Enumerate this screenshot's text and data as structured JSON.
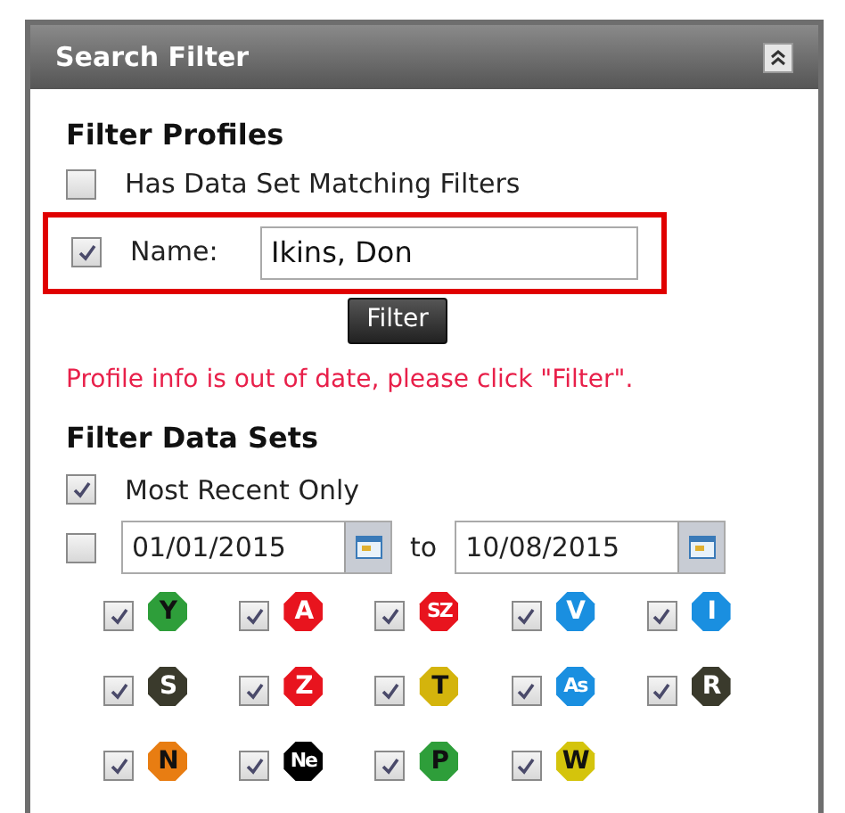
{
  "panel": {
    "title": "Search Filter"
  },
  "profiles": {
    "heading": "Filter Profiles",
    "has_data": {
      "label": "Has Data Set Matching Filters",
      "checked": false
    },
    "name": {
      "label": "Name:",
      "value": "Ikins, Don",
      "checked": true,
      "highlighted": true
    },
    "button": "Filter",
    "warning": "Profile info is out of date, please click \"Filter\"."
  },
  "data_sets": {
    "heading": "Filter Data Sets",
    "most_recent": {
      "label": "Most Recent Only",
      "checked": true
    },
    "date_range": {
      "checked": false,
      "from": "01/01/2015",
      "separator": "to",
      "to": "10/08/2015"
    },
    "badges": [
      {
        "label": "Y",
        "color": "#2e9e3a",
        "dark_text": true,
        "checked": true
      },
      {
        "label": "A",
        "color": "#e8141e",
        "dark_text": false,
        "checked": true
      },
      {
        "label": "SZ",
        "color": "#e8141e",
        "dark_text": false,
        "checked": true
      },
      {
        "label": "V",
        "color": "#1a8fe0",
        "dark_text": false,
        "checked": true
      },
      {
        "label": "I",
        "color": "#1a8fe0",
        "dark_text": false,
        "checked": true
      },
      {
        "label": "S",
        "color": "#3a3a2c",
        "dark_text": false,
        "checked": true
      },
      {
        "label": "Z",
        "color": "#e8141e",
        "dark_text": false,
        "checked": true
      },
      {
        "label": "T",
        "color": "#d4b40c",
        "dark_text": true,
        "checked": true
      },
      {
        "label": "As",
        "color": "#1a8fe0",
        "dark_text": false,
        "checked": true
      },
      {
        "label": "R",
        "color": "#3a3a2c",
        "dark_text": false,
        "checked": true
      },
      {
        "label": "N",
        "color": "#e87d12",
        "dark_text": true,
        "checked": true
      },
      {
        "label": "Ne",
        "color": "#000000",
        "dark_text": false,
        "checked": true
      },
      {
        "label": "P",
        "color": "#2e9e3a",
        "dark_text": true,
        "checked": true
      },
      {
        "label": "W",
        "color": "#d4c40c",
        "dark_text": true,
        "checked": true
      }
    ]
  }
}
